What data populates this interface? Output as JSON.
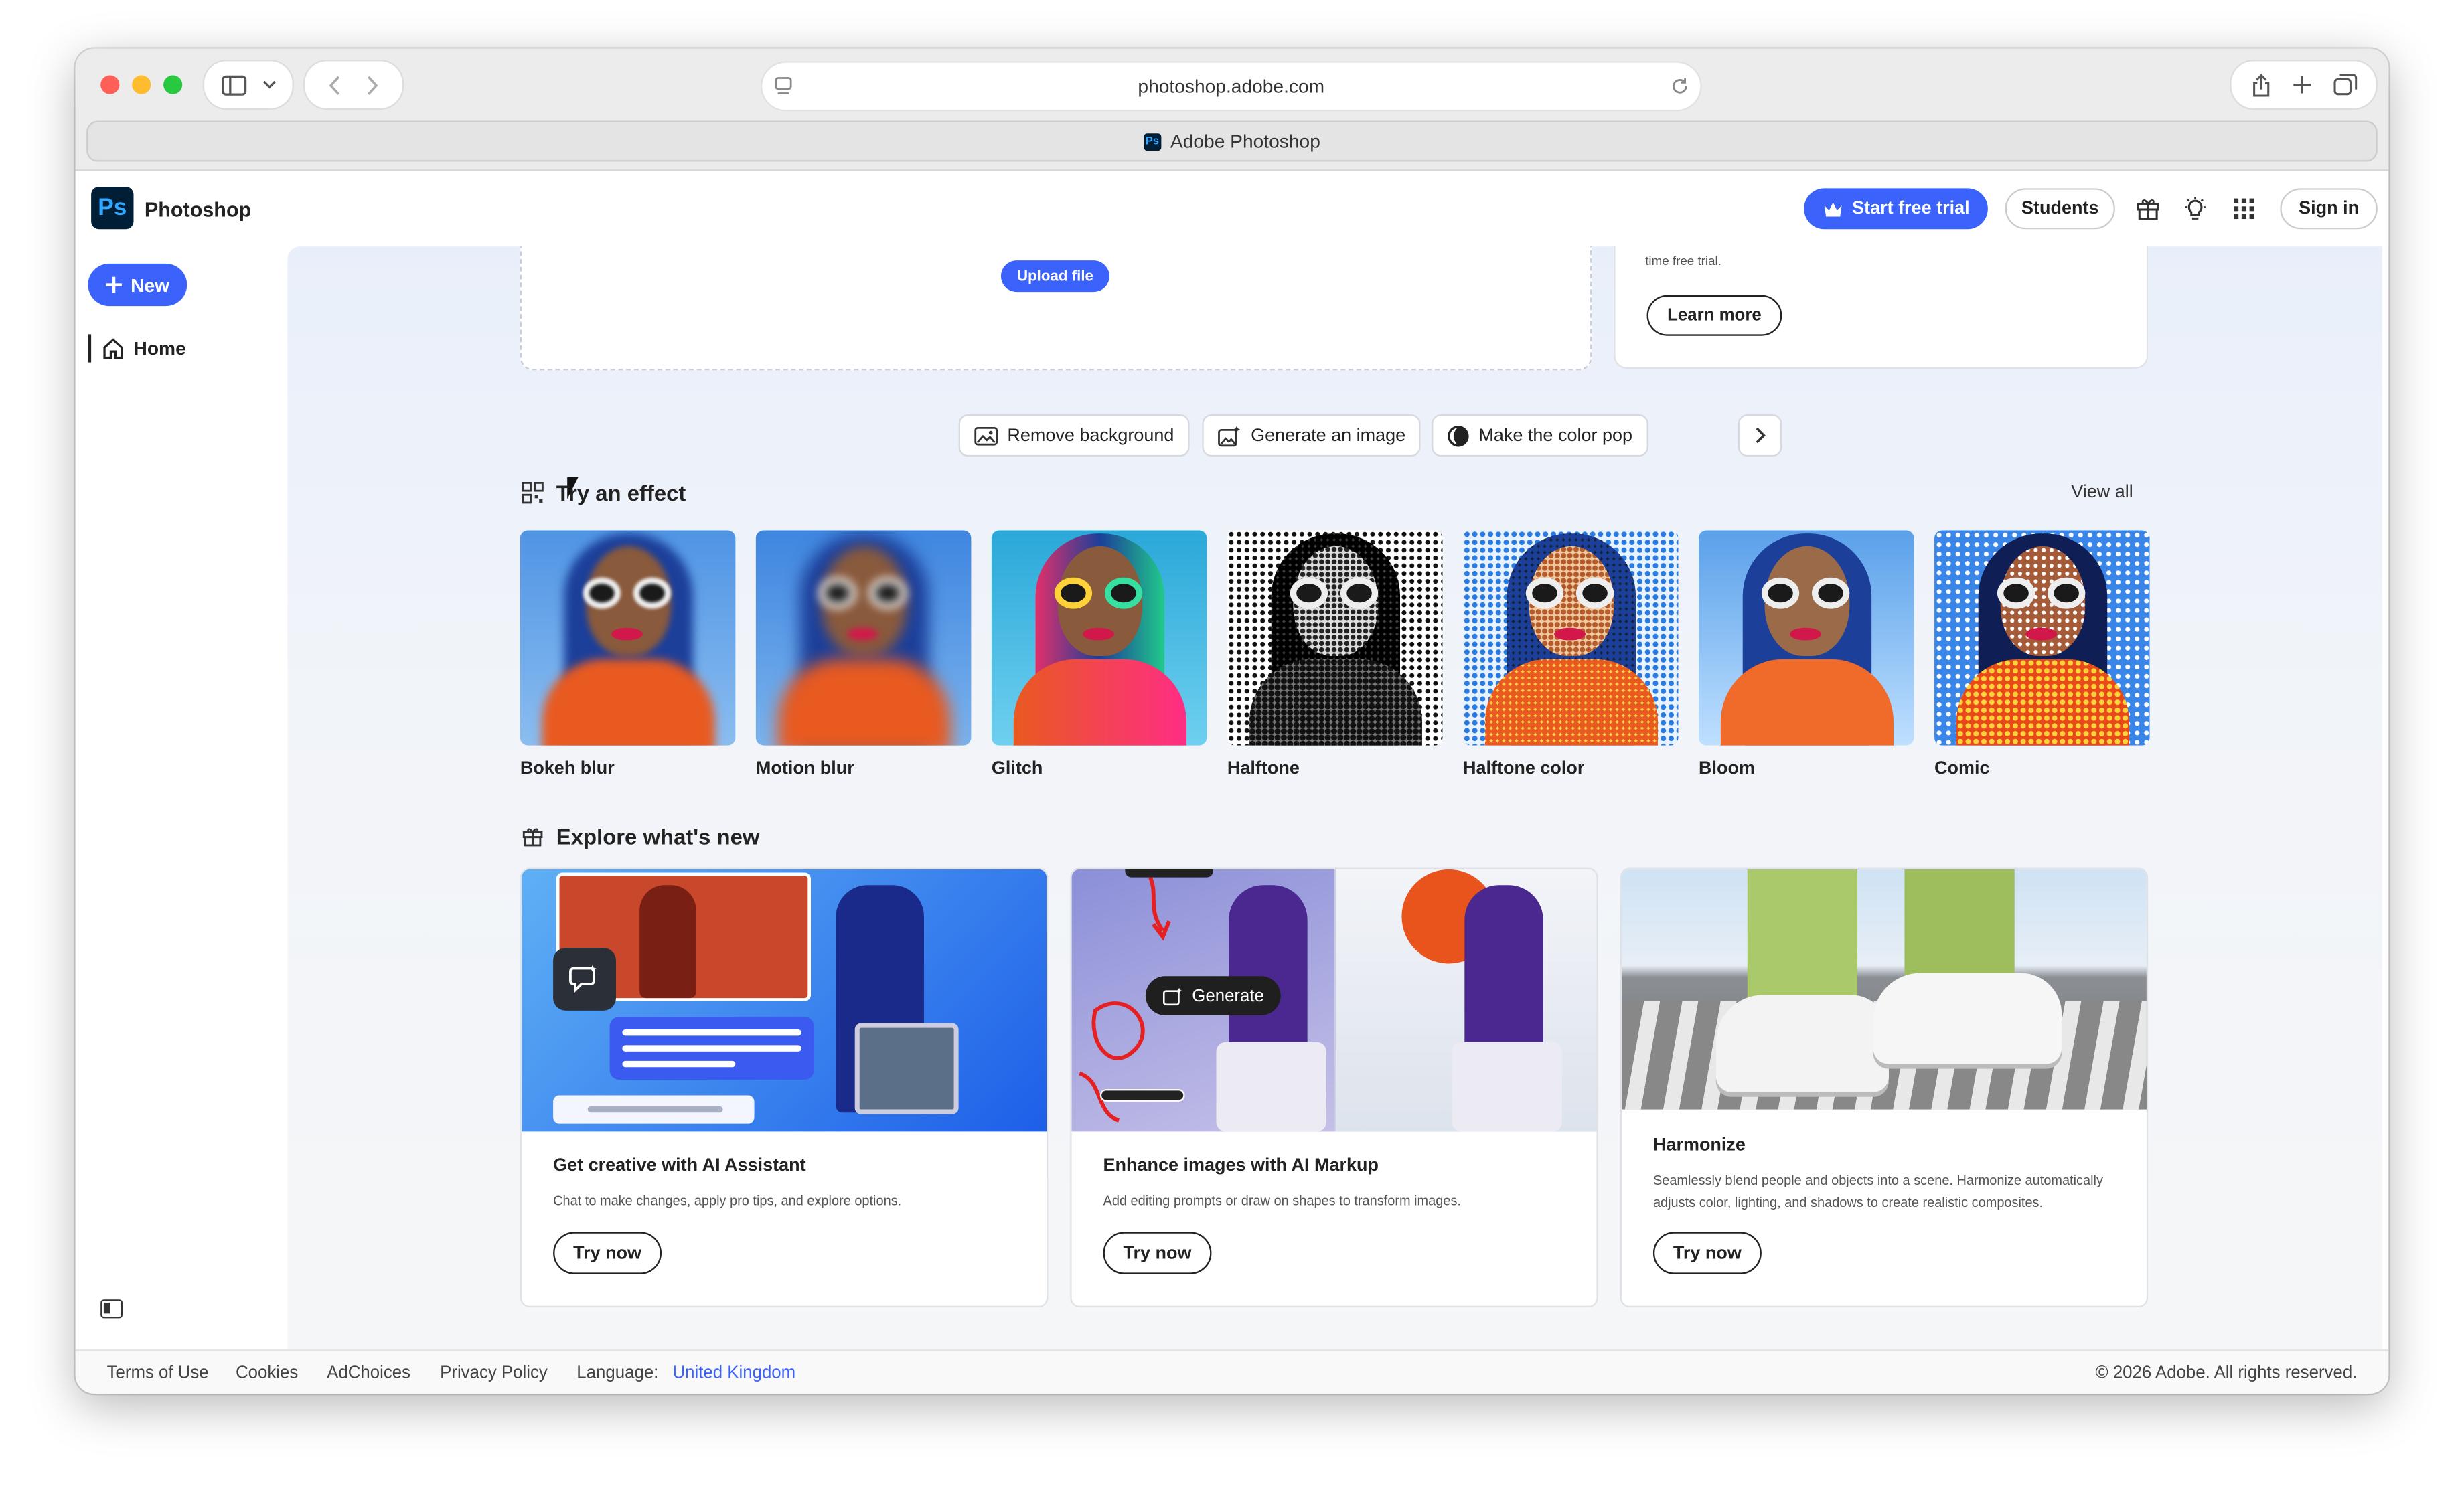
{
  "browser": {
    "url": "photoshop.adobe.com",
    "tab_title": "Adobe Photoshop"
  },
  "topbar": {
    "app_name": "Photoshop",
    "logo_text": "Ps",
    "start_trial_label": "Start free trial",
    "students_label": "Students",
    "sign_in_label": "Sign in"
  },
  "sidebar": {
    "new_label": "New",
    "home_label": "Home"
  },
  "upload": {
    "button_label": "Upload file"
  },
  "promo": {
    "text": "time free trial.",
    "learn_more_label": "Learn more"
  },
  "quick_actions": [
    {
      "label": "Remove background",
      "icon": "image-icon"
    },
    {
      "label": "Generate an image",
      "icon": "generate-image-icon"
    },
    {
      "label": "Make the color pop",
      "icon": "color-pop-icon"
    }
  ],
  "effects": {
    "title": "Try an effect",
    "view_all_label": "View all",
    "items": [
      {
        "label": "Bokeh blur"
      },
      {
        "label": "Motion blur"
      },
      {
        "label": "Glitch"
      },
      {
        "label": "Halftone"
      },
      {
        "label": "Halftone color"
      },
      {
        "label": "Bloom"
      },
      {
        "label": "Comic"
      }
    ]
  },
  "whats_new": {
    "title": "Explore what's new",
    "cards": [
      {
        "title": "Get creative with AI Assistant",
        "description": "Chat to make changes, apply pro tips, and explore options.",
        "button": "Try now"
      },
      {
        "title": "Enhance images with AI Markup",
        "description": "Add editing prompts or draw on shapes to transform images.",
        "button": "Try now",
        "overlay_label": "Generate"
      },
      {
        "title": "Harmonize",
        "description": "Seamlessly blend people and objects into a scene. Harmonize automatically adjusts color, lighting, and shadows to create realistic composites.",
        "button": "Try now"
      }
    ]
  },
  "footer": {
    "terms": "Terms of Use",
    "cookies": "Cookies",
    "adchoices": "AdChoices",
    "privacy": "Privacy Policy",
    "language_label": "Language:",
    "language_value": "United Kingdom",
    "copyright": "© 2026 Adobe. All rights reserved."
  },
  "colors": {
    "accent": "#3b63fb",
    "ps_dark": "#001e36",
    "ps_blue": "#31a8ff",
    "link": "#3b63fb"
  }
}
